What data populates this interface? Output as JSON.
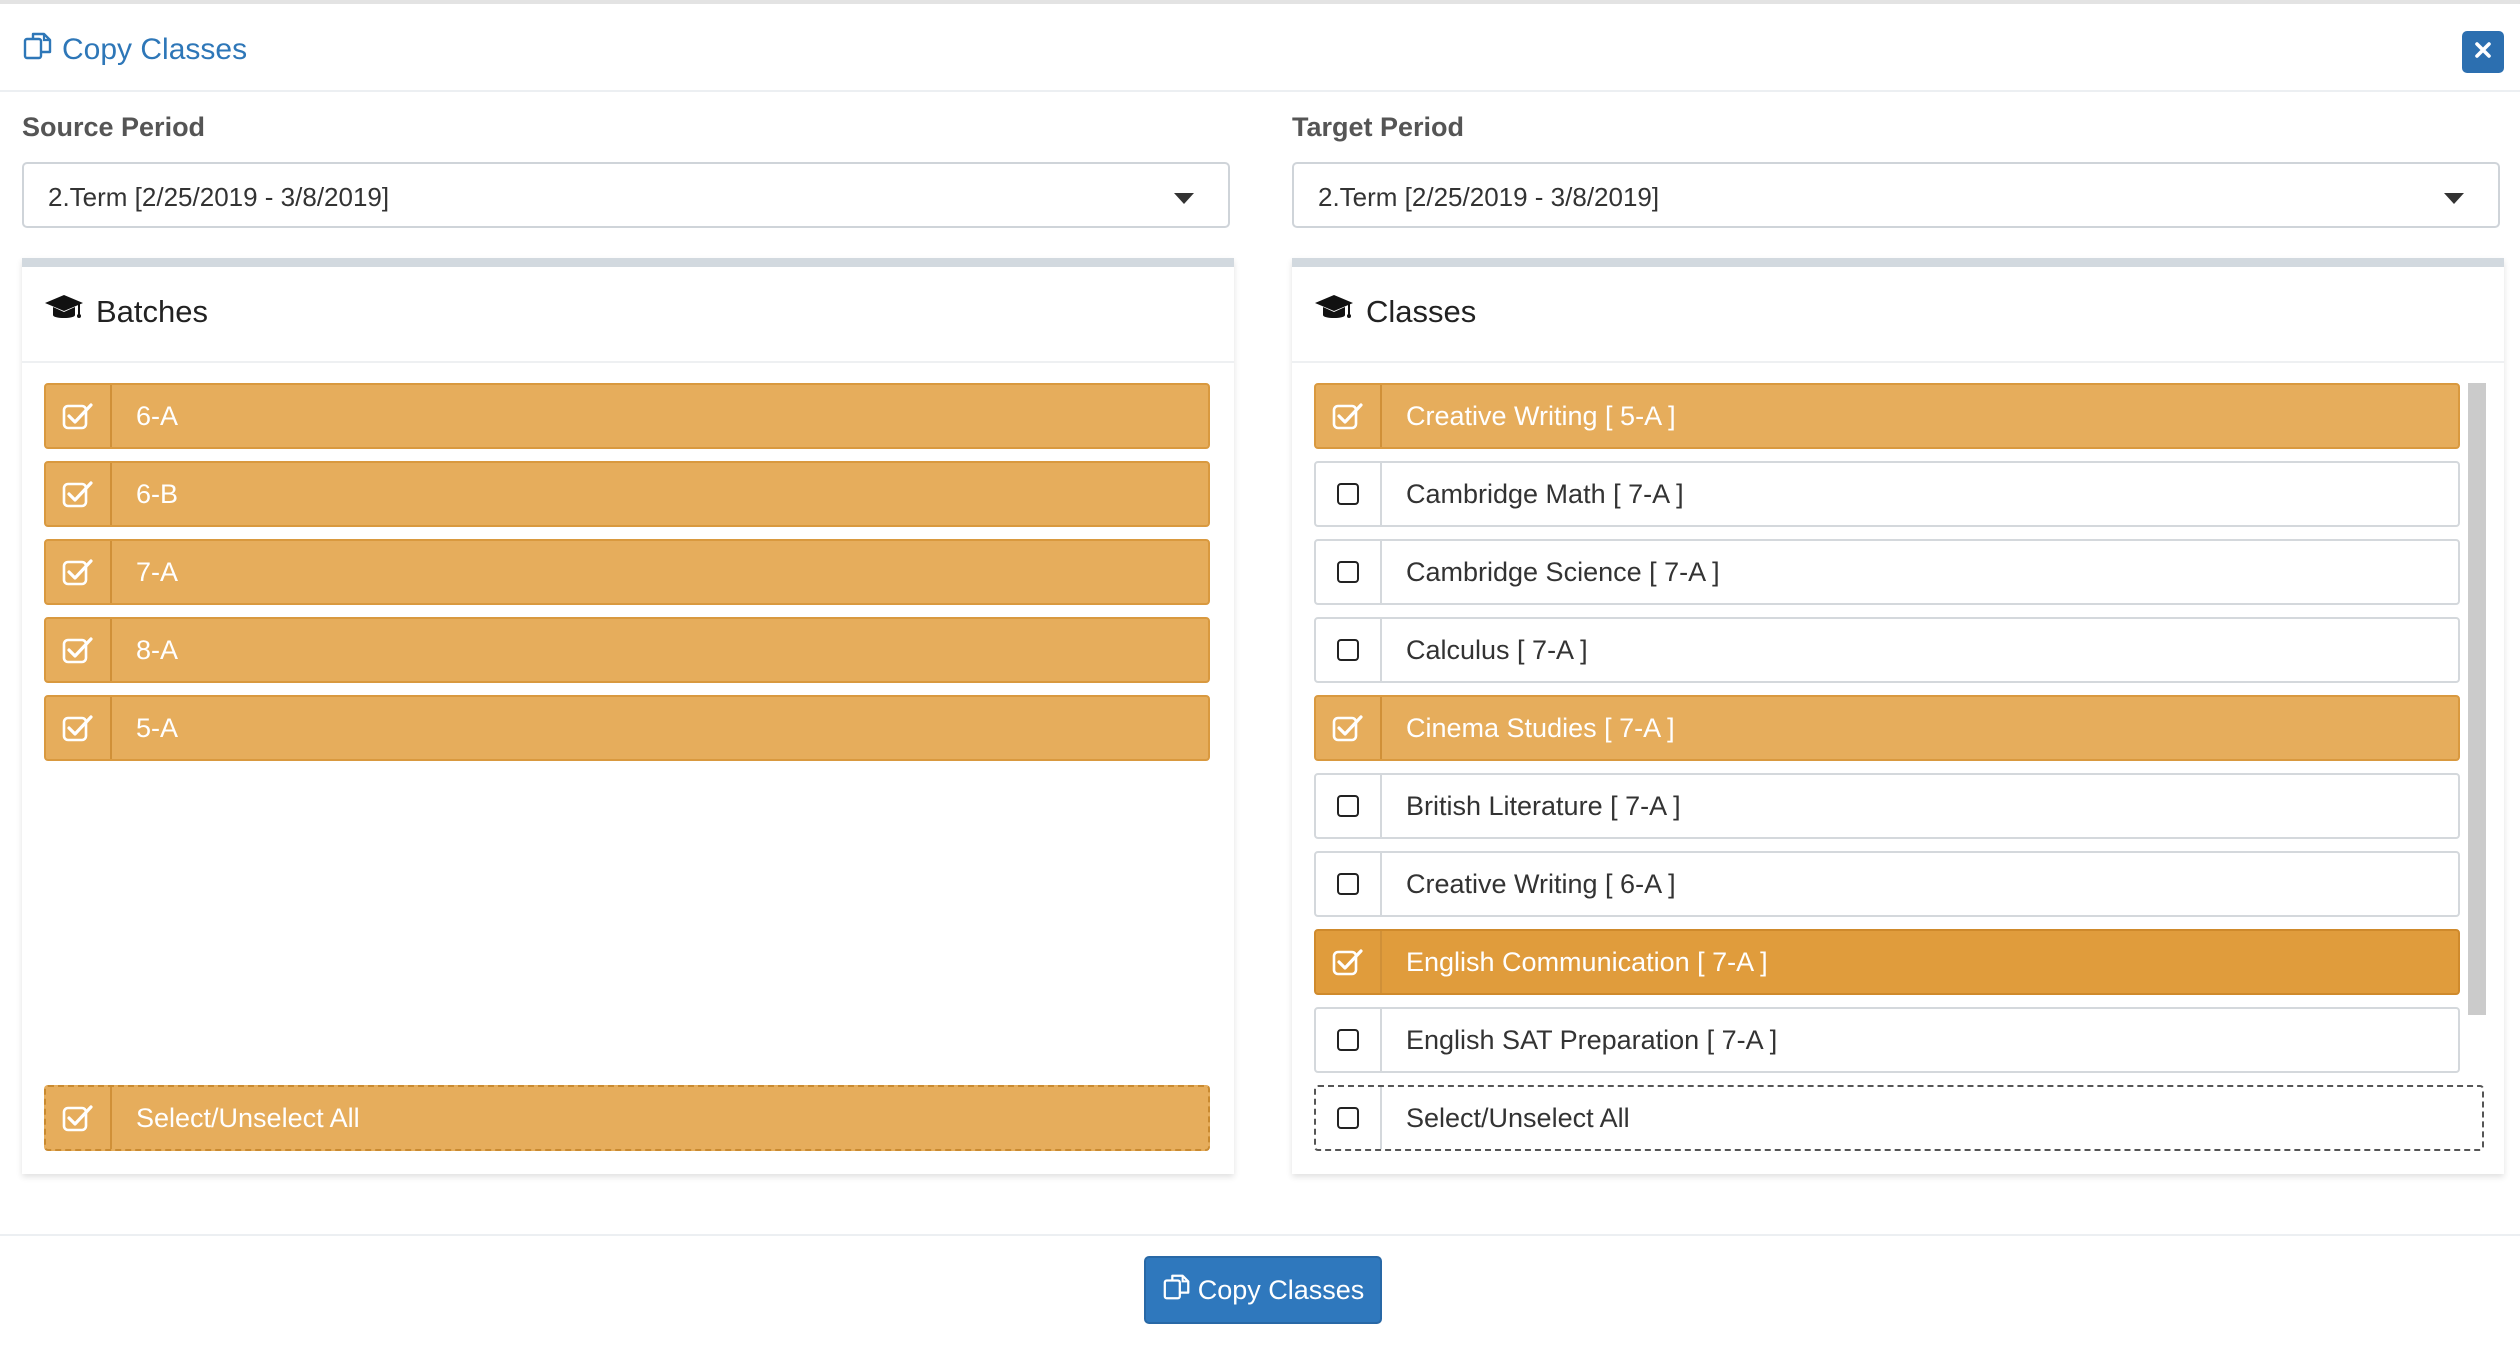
{
  "modal": {
    "title": "Copy Classes",
    "title_icon": "copy-icon",
    "close_icon": "close-icon",
    "accent_color": "#2e77b8",
    "check_color": "#e6ad5c"
  },
  "source": {
    "label": "Source Period",
    "selected": "2.Term [2/25/2019 - 3/8/2019]"
  },
  "target": {
    "label": "Target Period",
    "selected": "2.Term [2/25/2019 - 3/8/2019]"
  },
  "batches": {
    "title": "Batches",
    "icon": "graduation-cap-icon",
    "items": [
      {
        "label": "6-A",
        "checked": true
      },
      {
        "label": "6-B",
        "checked": true
      },
      {
        "label": "7-A",
        "checked": true
      },
      {
        "label": "8-A",
        "checked": true
      },
      {
        "label": "5-A",
        "checked": true
      }
    ],
    "select_all": {
      "label": "Select/Unselect All",
      "checked": true
    }
  },
  "classes": {
    "title": "Classes",
    "icon": "graduation-cap-icon",
    "items": [
      {
        "label": "Creative Writing [ 5-A ]",
        "checked": true
      },
      {
        "label": "Cambridge Math [ 7-A ]",
        "checked": false
      },
      {
        "label": "Cambridge Science [ 7-A ]",
        "checked": false
      },
      {
        "label": "Calculus [ 7-A ]",
        "checked": false
      },
      {
        "label": "Cinema Studies [ 7-A ]",
        "checked": true
      },
      {
        "label": "British Literature [ 7-A ]",
        "checked": false
      },
      {
        "label": "Creative Writing [ 6-A ]",
        "checked": false
      },
      {
        "label": "English Communication [ 7-A ]",
        "checked": true
      },
      {
        "label": "English SAT Preparation [ 7-A ]",
        "checked": false
      }
    ],
    "select_all": {
      "label": "Select/Unselect All",
      "checked": false
    }
  },
  "footer": {
    "copy_button": "Copy Classes"
  }
}
